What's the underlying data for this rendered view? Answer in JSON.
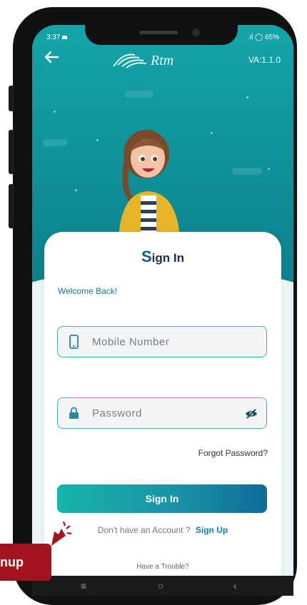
{
  "status": {
    "time": "3:37",
    "battery": "65%",
    "signal": ".ıl"
  },
  "header": {
    "version": "VA:1.1.0",
    "logo_text": "Rtm"
  },
  "card": {
    "title_initial": "S",
    "title_rest": "ign In",
    "welcome": "Welcome Back!",
    "mobile_placeholder": "Mobile Number",
    "password_placeholder": "Password",
    "forgot": "Forgot Password?",
    "signin_button": "Sign In",
    "no_account": "Don't have an Account ?",
    "signup_link": "Sign Up",
    "trouble": "Have a Trouble?"
  },
  "nav": {
    "menu": "≡",
    "home": "○",
    "back": "‹"
  },
  "callout": {
    "text": "nup"
  },
  "colors": {
    "accent": "#12a4a9",
    "callout": "#a3131d",
    "link": "#127fa8"
  }
}
